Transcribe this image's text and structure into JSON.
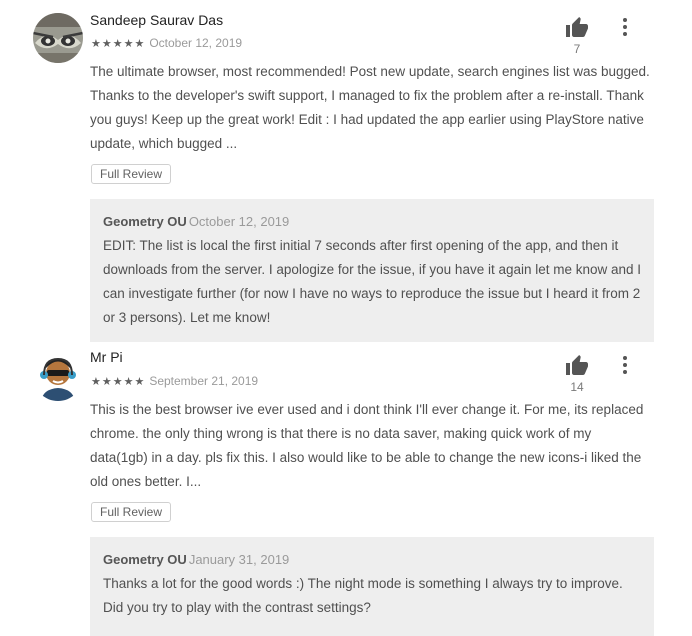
{
  "reviews": [
    {
      "author": "Sandeep Saurav Das",
      "stars": "★★★★★",
      "date": "October 12, 2019",
      "helpful_count": "7",
      "text": "The ultimate browser, most recommended! Post new update, search engines list was bugged. Thanks to the developer's swift support, I managed to fix the problem after a re-install. Thank you guys! Keep up the great work! Edit : I had updated the app earlier using PlayStore native update, which bugged ...",
      "full_review_label": "Full Review",
      "reply": {
        "author": "Geometry OU",
        "date": "October 12, 2019",
        "text": "EDIT: The list is local the first initial 7 seconds after first opening of the app, and then it downloads from the server. I apologize for the issue, if you have it again let me know and I can investigate further (for now I have no ways to reproduce the issue but I heard it from 2 or 3 persons). Let me know!"
      }
    },
    {
      "author": "Mr Pi",
      "stars": "★★★★★",
      "date": "September 21, 2019",
      "helpful_count": "14",
      "text": "This is the best browser ive ever used and i dont think I'll ever change it. For me, its replaced chrome. the only thing wrong is that there is no data saver, making quick work of my data(1gb) in a day. pls fix this. I also would like to be able to change the new icons-i liked the old ones better. I...",
      "full_review_label": "Full Review",
      "reply": {
        "author": "Geometry OU",
        "date": "January 31, 2019",
        "text": "Thanks a lot for the good words :) The night mode is something I always try to improve. Did you try to play with the contrast settings?"
      }
    }
  ],
  "icons": {
    "helpful": "thumb-up-icon",
    "more": "more-vert-icon"
  },
  "colors": {
    "reply_background": "#eeeeee",
    "star": "#5f5f5f"
  }
}
